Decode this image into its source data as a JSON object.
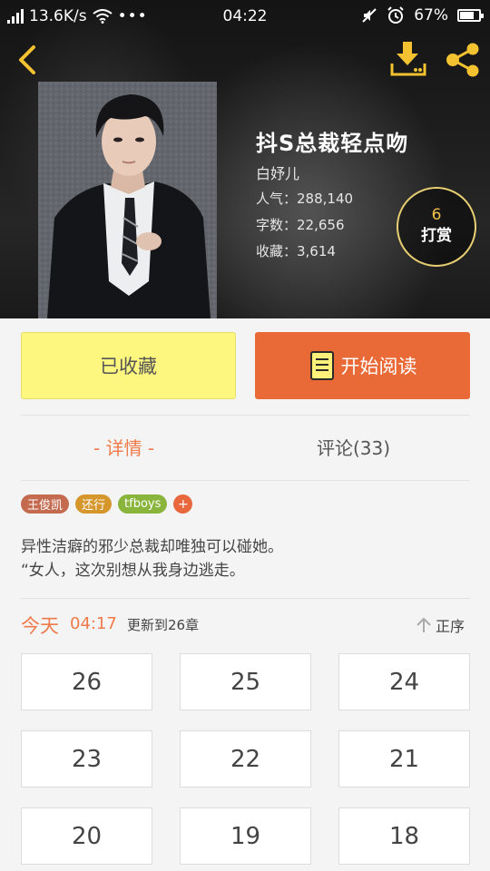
{
  "status_bar": {
    "net_speed": "13.6K/s",
    "dots": "•••",
    "time": "04:22",
    "battery_percent": "67%"
  },
  "header": {
    "back_icon": "chevron-left-icon",
    "download_icon": "download-icon",
    "share_icon": "share-icon",
    "accent_color": "#f2c230"
  },
  "book": {
    "title": "抖S总裁轻点吻",
    "author": "白妤儿",
    "popularity": "人气：288,140",
    "word_count": "字数：22,656",
    "favorites": "收藏：3,614",
    "reward_count": "6",
    "reward_label": "打赏"
  },
  "actions": {
    "favorited_label": "已收藏",
    "read_label": "开始阅读",
    "read_icon": "book-icon"
  },
  "tabs": {
    "detail": "- 详情 -",
    "comments": "评论(33)"
  },
  "tags": [
    {
      "label": "王俊凯",
      "color": "#c36a4f"
    },
    {
      "label": "还行",
      "color": "#d5962c"
    },
    {
      "label": "tfboys",
      "color": "#8ab53c"
    }
  ],
  "tag_more": "+",
  "description": {
    "line1": "异性洁癖的邪少总裁却唯独可以碰她。",
    "line2": "“女人，这次别想从我身边逃走。"
  },
  "update": {
    "day": "今天",
    "time": "04:17",
    "text": "更新到26章",
    "sort_label": "正序"
  },
  "chapters": [
    "26",
    "25",
    "24",
    "23",
    "22",
    "21",
    "20",
    "19",
    "18"
  ]
}
